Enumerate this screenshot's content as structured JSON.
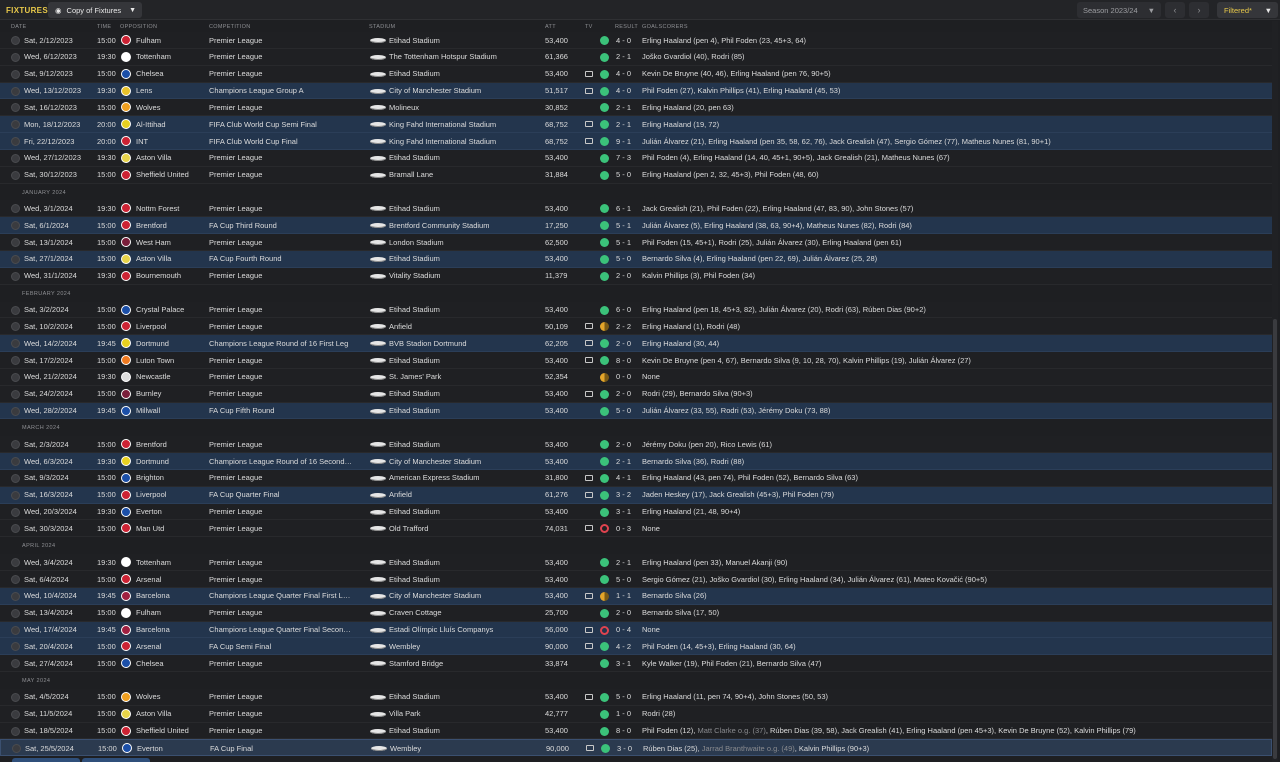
{
  "header": {
    "title": "FIXTURES",
    "view_label": "Copy of Fixtures",
    "season_label": "Season 2023/24",
    "filter_label": "Filtered*"
  },
  "columns": {
    "date": "DATE",
    "time": "TIME",
    "opposition": "OPPOSITION",
    "competition": "COMPETITION",
    "stadium": "STADIUM",
    "att": "ATT",
    "tv": "TV",
    "result": "RESULT",
    "goalscorers": "GOALSCORERS"
  },
  "colors": {
    "accent": "#e7c84a",
    "win": "#3bc27a",
    "draw": "#e3a52a",
    "loss": "#e0434f",
    "highlight_row": "#23354d"
  },
  "rows": [
    {
      "kind": "match",
      "hl": false,
      "date": "Sat, 2/12/2023",
      "time": "15:00",
      "opp": "Fulham",
      "crest": "#cc2233",
      "comp": "Premier League",
      "stadium": "Etihad Stadium",
      "att": "53,400",
      "tv": false,
      "res": "W",
      "score": "4 - 0",
      "scorers": [
        {
          "t": "Erling Haaland (pen 4), Phil Foden (23, 45+3, 64)"
        }
      ]
    },
    {
      "kind": "match",
      "hl": false,
      "date": "Wed, 6/12/2023",
      "time": "19:30",
      "opp": "Tottenham",
      "crest": "#ffffff",
      "comp": "Premier League",
      "stadium": "The Tottenham Hotspur Stadium",
      "att": "61,366",
      "tv": false,
      "res": "W",
      "score": "2 - 1",
      "scorers": [
        {
          "t": "Joško Gvardiol (40), Rodri (85)"
        }
      ]
    },
    {
      "kind": "match",
      "hl": false,
      "date": "Sat, 9/12/2023",
      "time": "15:00",
      "opp": "Chelsea",
      "crest": "#1b4fa8",
      "comp": "Premier League",
      "stadium": "Etihad Stadium",
      "att": "53,400",
      "tv": true,
      "res": "W",
      "score": "4 - 0",
      "scorers": [
        {
          "t": "Kevin De Bruyne (40, 46), Erling Haaland (pen 76, 90+5)"
        }
      ]
    },
    {
      "kind": "match",
      "hl": true,
      "date": "Wed, 13/12/2023",
      "time": "19:30",
      "opp": "Lens",
      "crest": "#e8c22a",
      "comp": "Champions League Group A",
      "stadium": "City of Manchester Stadium",
      "att": "51,517",
      "tv": true,
      "res": "W",
      "score": "4 - 0",
      "scorers": [
        {
          "t": "Phil Foden (27), Kalvin Phillips (41), Erling Haaland (45, 53)"
        }
      ]
    },
    {
      "kind": "match",
      "hl": false,
      "date": "Sat, 16/12/2023",
      "time": "15:00",
      "opp": "Wolves",
      "crest": "#f0a020",
      "comp": "Premier League",
      "stadium": "Molineux",
      "att": "30,852",
      "tv": false,
      "res": "W",
      "score": "2 - 1",
      "scorers": [
        {
          "t": "Erling Haaland (20, pen 63)"
        }
      ]
    },
    {
      "kind": "match",
      "hl": true,
      "date": "Mon, 18/12/2023",
      "time": "20:00",
      "opp": "Al-Ittihad",
      "crest": "#e8d020",
      "comp": "FIFA Club World Cup Semi Final",
      "stadium": "King Fahd International Stadium",
      "att": "68,752",
      "tv": true,
      "res": "W",
      "score": "2 - 1",
      "scorers": [
        {
          "t": "Erling Haaland (19, 72)"
        }
      ]
    },
    {
      "kind": "match",
      "hl": true,
      "date": "Fri, 22/12/2023",
      "time": "20:00",
      "opp": "INT",
      "crest": "#cc2233",
      "comp": "FIFA Club World Cup Final",
      "stadium": "King Fahd International Stadium",
      "att": "68,752",
      "tv": true,
      "res": "W",
      "score": "9 - 1",
      "scorers": [
        {
          "t": "Julián Álvarez (21), Erling Haaland (pen 35, 58, 62, 76), Jack Grealish (47), Sergio Gómez (77), Matheus Nunes (81, 90+1)"
        }
      ]
    },
    {
      "kind": "match",
      "hl": false,
      "date": "Wed, 27/12/2023",
      "time": "19:30",
      "opp": "Aston Villa",
      "crest": "#e8d44a",
      "comp": "Premier League",
      "stadium": "Etihad Stadium",
      "att": "53,400",
      "tv": false,
      "res": "W",
      "score": "7 - 3",
      "scorers": [
        {
          "t": "Phil Foden (4), Erling Haaland (14, 40, 45+1, 90+5), Jack Grealish (21), Matheus Nunes (67)"
        }
      ]
    },
    {
      "kind": "match",
      "hl": false,
      "date": "Sat, 30/12/2023",
      "time": "15:00",
      "opp": "Sheffield United",
      "crest": "#cc2233",
      "comp": "Premier League",
      "stadium": "Bramall Lane",
      "att": "31,884",
      "tv": false,
      "res": "W",
      "score": "5 - 0",
      "scorers": [
        {
          "t": "Erling Haaland (pen 2, 32, 45+3), Phil Foden (48, 60)"
        }
      ]
    },
    {
      "kind": "section",
      "label": "JANUARY 2024"
    },
    {
      "kind": "match",
      "hl": false,
      "date": "Wed, 3/1/2024",
      "time": "19:30",
      "opp": "Nottm Forest",
      "crest": "#cc2233",
      "comp": "Premier League",
      "stadium": "Etihad Stadium",
      "att": "53,400",
      "tv": false,
      "res": "W",
      "score": "6 - 1",
      "scorers": [
        {
          "t": "Jack Grealish (21), Phil Foden (22), Erling Haaland (47, 83, 90), John Stones (57)"
        }
      ]
    },
    {
      "kind": "match",
      "hl": true,
      "date": "Sat, 6/1/2024",
      "time": "15:00",
      "opp": "Brentford",
      "crest": "#cc2233",
      "comp": "FA Cup Third Round",
      "stadium": "Brentford Community Stadium",
      "att": "17,250",
      "tv": false,
      "res": "W",
      "score": "5 - 1",
      "scorers": [
        {
          "t": "Julián Álvarez (5), Erling Haaland (38, 63, 90+4), Matheus Nunes (82), Rodri (84)"
        }
      ]
    },
    {
      "kind": "match",
      "hl": false,
      "date": "Sat, 13/1/2024",
      "time": "15:00",
      "opp": "West Ham",
      "crest": "#7a1f3a",
      "comp": "Premier League",
      "stadium": "London Stadium",
      "att": "62,500",
      "tv": false,
      "res": "W",
      "score": "5 - 1",
      "scorers": [
        {
          "t": "Phil Foden (15, 45+1), Rodri (25), Julián Álvarez (30), Erling Haaland (pen 61)"
        }
      ]
    },
    {
      "kind": "match",
      "hl": true,
      "date": "Sat, 27/1/2024",
      "time": "15:00",
      "opp": "Aston Villa",
      "crest": "#e8d44a",
      "comp": "FA Cup Fourth Round",
      "stadium": "Etihad Stadium",
      "att": "53,400",
      "tv": false,
      "res": "W",
      "score": "5 - 0",
      "scorers": [
        {
          "t": "Bernardo Silva (4), Erling Haaland (pen 22, 69), Julián Álvarez (25, 28)"
        }
      ]
    },
    {
      "kind": "match",
      "hl": false,
      "date": "Wed, 31/1/2024",
      "time": "19:30",
      "opp": "Bournemouth",
      "crest": "#cc2233",
      "comp": "Premier League",
      "stadium": "Vitality Stadium",
      "att": "11,379",
      "tv": false,
      "res": "W",
      "score": "2 - 0",
      "scorers": [
        {
          "t": "Kalvin Phillips (3), Phil Foden (34)"
        }
      ]
    },
    {
      "kind": "section",
      "label": "FEBRUARY 2024"
    },
    {
      "kind": "match",
      "hl": false,
      "date": "Sat, 3/2/2024",
      "time": "15:00",
      "opp": "Crystal Palace",
      "crest": "#1b4fa8",
      "comp": "Premier League",
      "stadium": "Etihad Stadium",
      "att": "53,400",
      "tv": false,
      "res": "W",
      "score": "6 - 0",
      "scorers": [
        {
          "t": "Erling Haaland (pen 18, 45+3, 82), Julián Álvarez (20), Rodri (63), Rúben Dias (90+2)"
        }
      ]
    },
    {
      "kind": "match",
      "hl": false,
      "date": "Sat, 10/2/2024",
      "time": "15:00",
      "opp": "Liverpool",
      "crest": "#cc2233",
      "comp": "Premier League",
      "stadium": "Anfield",
      "att": "50,109",
      "tv": true,
      "res": "D",
      "score": "2 - 2",
      "scorers": [
        {
          "t": "Erling Haaland (1), Rodri (48)"
        }
      ]
    },
    {
      "kind": "match",
      "hl": true,
      "date": "Wed, 14/2/2024",
      "time": "19:45",
      "opp": "Dortmund",
      "crest": "#e8d020",
      "comp": "Champions League Round of 16  First Leg",
      "stadium": "BVB Stadion Dortmund",
      "att": "62,205",
      "tv": true,
      "res": "W",
      "score": "2 - 0",
      "scorers": [
        {
          "t": "Erling Haaland (30, 44)"
        }
      ]
    },
    {
      "kind": "match",
      "hl": false,
      "date": "Sat, 17/2/2024",
      "time": "15:00",
      "opp": "Luton Town",
      "crest": "#f07a20",
      "comp": "Premier League",
      "stadium": "Etihad Stadium",
      "att": "53,400",
      "tv": true,
      "res": "W",
      "score": "8 - 0",
      "scorers": [
        {
          "t": "Kevin De Bruyne (pen 4, 67), Bernardo Silva (9, 10, 28, 70), Kalvin Phillips (19), Julián Álvarez (27)"
        }
      ]
    },
    {
      "kind": "match",
      "hl": false,
      "date": "Wed, 21/2/2024",
      "time": "19:30",
      "opp": "Newcastle",
      "crest": "#dddddd",
      "comp": "Premier League",
      "stadium": "St. James' Park",
      "att": "52,354",
      "tv": false,
      "res": "D",
      "score": "0 - 0",
      "scorers": [
        {
          "t": "None"
        }
      ]
    },
    {
      "kind": "match",
      "hl": false,
      "date": "Sat, 24/2/2024",
      "time": "15:00",
      "opp": "Burnley",
      "crest": "#7a1f3a",
      "comp": "Premier League",
      "stadium": "Etihad Stadium",
      "att": "53,400",
      "tv": true,
      "res": "W",
      "score": "2 - 0",
      "scorers": [
        {
          "t": "Rodri (29), Bernardo Silva (90+3)"
        }
      ]
    },
    {
      "kind": "match",
      "hl": true,
      "date": "Wed, 28/2/2024",
      "time": "19:45",
      "opp": "Millwall",
      "crest": "#1b4fa8",
      "comp": "FA Cup Fifth Round",
      "stadium": "Etihad Stadium",
      "att": "53,400",
      "tv": false,
      "res": "W",
      "score": "5 - 0",
      "scorers": [
        {
          "t": "Julián Álvarez (33, 55), Rodri (53), Jérémy Doku (73, 88)"
        }
      ]
    },
    {
      "kind": "section",
      "label": "MARCH 2024"
    },
    {
      "kind": "match",
      "hl": false,
      "date": "Sat, 2/3/2024",
      "time": "15:00",
      "opp": "Brentford",
      "crest": "#cc2233",
      "comp": "Premier League",
      "stadium": "Etihad Stadium",
      "att": "53,400",
      "tv": false,
      "res": "W",
      "score": "2 - 0",
      "scorers": [
        {
          "t": "Jérémy Doku (pen 20), Rico Lewis (61)"
        }
      ]
    },
    {
      "kind": "match",
      "hl": true,
      "date": "Wed, 6/3/2024",
      "time": "19:30",
      "opp": "Dortmund",
      "crest": "#e8d020",
      "comp": "Champions League Round of 16  Second…",
      "stadium": "City of Manchester Stadium",
      "att": "53,400",
      "tv": false,
      "res": "W",
      "score": "2 - 1",
      "scorers": [
        {
          "t": "Bernardo Silva (36), Rodri (88)"
        }
      ]
    },
    {
      "kind": "match",
      "hl": false,
      "date": "Sat, 9/3/2024",
      "time": "15:00",
      "opp": "Brighton",
      "crest": "#1b4fa8",
      "comp": "Premier League",
      "stadium": "American Express Stadium",
      "att": "31,800",
      "tv": true,
      "res": "W",
      "score": "4 - 1",
      "scorers": [
        {
          "t": "Erling Haaland (43, pen 74), Phil Foden (52), Bernardo Silva (63)"
        }
      ]
    },
    {
      "kind": "match",
      "hl": true,
      "date": "Sat, 16/3/2024",
      "time": "15:00",
      "opp": "Liverpool",
      "crest": "#cc2233",
      "comp": "FA Cup Quarter Final",
      "stadium": "Anfield",
      "att": "61,276",
      "tv": true,
      "res": "W",
      "score": "3 - 2",
      "scorers": [
        {
          "t": "Jaden Heskey (17), Jack Grealish (45+3), Phil Foden (79)"
        }
      ]
    },
    {
      "kind": "match",
      "hl": false,
      "date": "Wed, 20/3/2024",
      "time": "19:30",
      "opp": "Everton",
      "crest": "#1b4fa8",
      "comp": "Premier League",
      "stadium": "Etihad Stadium",
      "att": "53,400",
      "tv": false,
      "res": "W",
      "score": "3 - 1",
      "scorers": [
        {
          "t": "Erling Haaland (21, 48, 90+4)"
        }
      ]
    },
    {
      "kind": "match",
      "hl": false,
      "date": "Sat, 30/3/2024",
      "time": "15:00",
      "opp": "Man Utd",
      "crest": "#cc2233",
      "comp": "Premier League",
      "stadium": "Old Trafford",
      "att": "74,031",
      "tv": true,
      "res": "L",
      "score": "0 - 3",
      "scorers": [
        {
          "t": "None"
        }
      ]
    },
    {
      "kind": "section",
      "label": "APRIL 2024"
    },
    {
      "kind": "match",
      "hl": false,
      "date": "Wed, 3/4/2024",
      "time": "19:30",
      "opp": "Tottenham",
      "crest": "#ffffff",
      "comp": "Premier League",
      "stadium": "Etihad Stadium",
      "att": "53,400",
      "tv": false,
      "res": "W",
      "score": "2 - 1",
      "scorers": [
        {
          "t": "Erling Haaland (pen 33), Manuel Akanji (90)"
        }
      ]
    },
    {
      "kind": "match",
      "hl": false,
      "date": "Sat, 6/4/2024",
      "time": "15:00",
      "opp": "Arsenal",
      "crest": "#cc2233",
      "comp": "Premier League",
      "stadium": "Etihad Stadium",
      "att": "53,400",
      "tv": false,
      "res": "W",
      "score": "5 - 0",
      "scorers": [
        {
          "t": "Sergio Gómez (21), Joško Gvardiol (30), Erling Haaland (34), Julián Álvarez (61), Mateo Kovačić (90+5)"
        }
      ]
    },
    {
      "kind": "match",
      "hl": true,
      "date": "Wed, 10/4/2024",
      "time": "19:45",
      "opp": "Barcelona",
      "crest": "#a02040",
      "comp": "Champions League Quarter Final First L…",
      "stadium": "City of Manchester Stadium",
      "att": "53,400",
      "tv": true,
      "res": "D",
      "score": "1 - 1",
      "scorers": [
        {
          "t": "Bernardo Silva (26)"
        }
      ]
    },
    {
      "kind": "match",
      "hl": false,
      "date": "Sat, 13/4/2024",
      "time": "15:00",
      "opp": "Fulham",
      "crest": "#ffffff",
      "comp": "Premier League",
      "stadium": "Craven Cottage",
      "att": "25,700",
      "tv": false,
      "res": "W",
      "score": "2 - 0",
      "scorers": [
        {
          "t": "Bernardo Silva (17, 50)"
        }
      ]
    },
    {
      "kind": "match",
      "hl": true,
      "date": "Wed, 17/4/2024",
      "time": "19:45",
      "opp": "Barcelona",
      "crest": "#a02040",
      "comp": "Champions League Quarter Final Secon…",
      "stadium": "Estadi Olímpic Lluís Companys",
      "att": "56,000",
      "tv": true,
      "res": "L",
      "score": "0 - 4",
      "scorers": [
        {
          "t": "None"
        }
      ]
    },
    {
      "kind": "match",
      "hl": true,
      "date": "Sat, 20/4/2024",
      "time": "15:00",
      "opp": "Arsenal",
      "crest": "#cc2233",
      "comp": "FA Cup Semi Final",
      "stadium": "Wembley",
      "att": "90,000",
      "tv": true,
      "res": "W",
      "score": "4 - 2",
      "scorers": [
        {
          "t": "Phil Foden (14, 45+3), Erling Haaland (30, 64)"
        }
      ]
    },
    {
      "kind": "match",
      "hl": false,
      "date": "Sat, 27/4/2024",
      "time": "15:00",
      "opp": "Chelsea",
      "crest": "#1b4fa8",
      "comp": "Premier League",
      "stadium": "Stamford Bridge",
      "att": "33,874",
      "tv": false,
      "res": "W",
      "score": "3 - 1",
      "scorers": [
        {
          "t": "Kyle Walker (19), Phil Foden (21), Bernardo Silva (47)"
        }
      ]
    },
    {
      "kind": "section",
      "label": "MAY 2024"
    },
    {
      "kind": "match",
      "hl": false,
      "date": "Sat, 4/5/2024",
      "time": "15:00",
      "opp": "Wolves",
      "crest": "#f0a020",
      "comp": "Premier League",
      "stadium": "Etihad Stadium",
      "att": "53,400",
      "tv": true,
      "res": "W",
      "score": "5 - 0",
      "scorers": [
        {
          "t": "Erling Haaland (11, pen 74, 90+4), John Stones (50, 53)"
        }
      ]
    },
    {
      "kind": "match",
      "hl": false,
      "date": "Sat, 11/5/2024",
      "time": "15:00",
      "opp": "Aston Villa",
      "crest": "#e8d44a",
      "comp": "Premier League",
      "stadium": "Villa Park",
      "att": "42,777",
      "tv": false,
      "res": "W",
      "score": "1 - 0",
      "scorers": [
        {
          "t": "Rodri (28)"
        }
      ]
    },
    {
      "kind": "match",
      "hl": false,
      "date": "Sat, 18/5/2024",
      "time": "15:00",
      "opp": "Sheffield United",
      "crest": "#cc2233",
      "comp": "Premier League",
      "stadium": "Etihad Stadium",
      "att": "53,400",
      "tv": false,
      "res": "W",
      "score": "8 - 0",
      "scorers": [
        {
          "t": "Phil Foden (12), "
        },
        {
          "t": "Matt Clarke o.g. (37)",
          "og": true
        },
        {
          "t": ", Rúben Dias (39, 58), Jack Grealish (41), Erling Haaland (pen 45+3), Kevin De Bruyne (52), Kalvin Phillips (79)"
        }
      ]
    },
    {
      "kind": "match",
      "hl": false,
      "sel": true,
      "date": "Sat, 25/5/2024",
      "time": "15:00",
      "opp": "Everton",
      "crest": "#1b4fa8",
      "comp": "FA Cup Final",
      "stadium": "Wembley",
      "att": "90,000",
      "tv": true,
      "res": "W",
      "score": "3 - 0",
      "scorers": [
        {
          "t": "Rúben Dias (25), "
        },
        {
          "t": "Jarrad Branthwaite o.g. (49)",
          "og": true
        },
        {
          "t": ", Kalvin Phillips (90+3)"
        }
      ]
    }
  ]
}
